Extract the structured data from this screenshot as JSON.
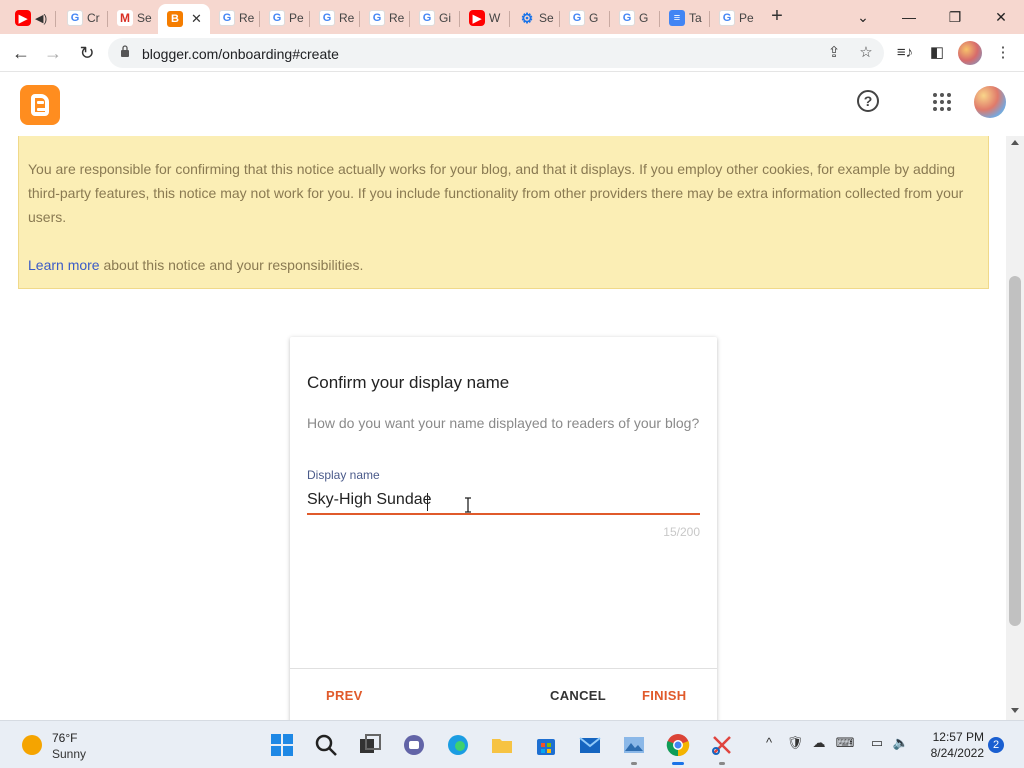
{
  "browser": {
    "tabs": [
      {
        "icon": "youtube-icon",
        "title": "",
        "audio": true
      },
      {
        "icon": "google-icon",
        "title": "Cr"
      },
      {
        "icon": "gmail-icon",
        "title": "Se"
      },
      {
        "icon": "blogger-icon",
        "title": "",
        "active": true
      },
      {
        "icon": "google-icon",
        "title": "Re"
      },
      {
        "icon": "google-icon",
        "title": "Pe"
      },
      {
        "icon": "google-icon",
        "title": "Re"
      },
      {
        "icon": "google-icon",
        "title": "Re"
      },
      {
        "icon": "google-icon",
        "title": "Gi"
      },
      {
        "icon": "youtube-icon",
        "title": "W"
      },
      {
        "icon": "settings-icon",
        "title": "Se"
      },
      {
        "icon": "google-icon",
        "title": "G"
      },
      {
        "icon": "google-icon",
        "title": "G"
      },
      {
        "icon": "docs-icon",
        "title": "Ta"
      },
      {
        "icon": "google-icon",
        "title": "Pe"
      }
    ],
    "url": "blogger.com/onboarding#create"
  },
  "notice": {
    "text1": "You are responsible for confirming that this notice actually works for your blog, and that it displays. If you employ other cookies, for example by adding third-party features, this notice may not work for you. If you include functionality from other providers there may be extra information collected from your users.",
    "link": "Learn more",
    "text2": " about this notice and your responsibilities."
  },
  "dialog": {
    "title": "Confirm your display name",
    "subtitle": "How do you want your name displayed to readers of your blog?",
    "field_label": "Display name",
    "field_value": "Sky-High Sundae",
    "counter": "15/200",
    "prev": "PREV",
    "cancel": "CANCEL",
    "finish": "FINISH"
  },
  "taskbar": {
    "weather_temp": "76°F",
    "weather_cond": "Sunny",
    "time": "12:57 PM",
    "date": "8/24/2022",
    "notifications": "2"
  },
  "colors": {
    "accent": "#e05a2b",
    "blogger_orange": "#ff8d1f",
    "notice_bg": "#fbeeb5",
    "link": "#3b5bc7"
  }
}
